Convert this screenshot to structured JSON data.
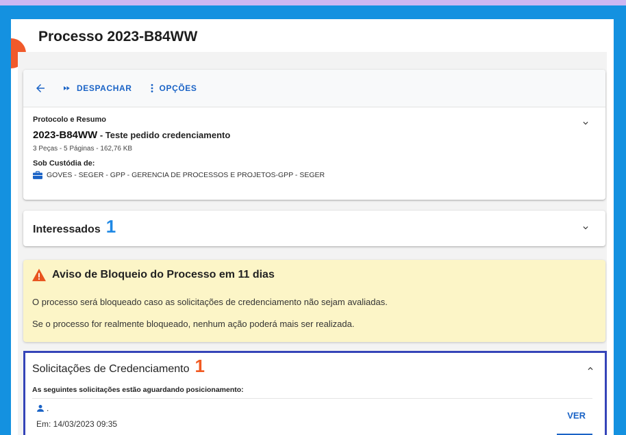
{
  "page": {
    "title": "Processo 2023-B84WW"
  },
  "toolbar": {
    "despachar_label": "DESPACHAR",
    "opcoes_label": "OPÇÕES"
  },
  "protocolo": {
    "section_label": "Protocolo e Resumo",
    "number": "2023-B84WW",
    "summary": " - Teste pedido credenciamento",
    "meta": "3 Peças - 5 Páginas - 162,76 KB",
    "custody_label": "Sob Custódia de:",
    "custody_value": "GOVES - SEGER - GPP - GERENCIA DE PROCESSOS E PROJETOS-GPP - SEGER"
  },
  "interessados": {
    "title": "Interessados",
    "count": "1"
  },
  "aviso": {
    "title": "Aviso de Bloqueio do Processo em 11 dias",
    "line1": "O processo será bloqueado caso as solicitações de credenciamento não sejam avaliadas.",
    "line2": "Se o processo for realmente bloqueado, nenhum ação poderá mais ser realizada."
  },
  "solicitacoes": {
    "title": "Solicitações de Credenciamento",
    "count": "1",
    "subtitle": "As seguintes solicitações estão aguardando posicionamento:",
    "items": [
      {
        "name": ".",
        "date": "Em: 14/03/2023 09:35",
        "action_label": "VER"
      }
    ]
  },
  "colors": {
    "accent_blue": "#1a63c6",
    "count_blue": "#1e88e5",
    "count_orange": "#f15a22",
    "warning_bg": "#fcf5c7",
    "warning_icon": "#e8541e",
    "highlight_border": "#3544b8"
  },
  "icons": [
    "arrow-left-icon",
    "fast-forward-icon",
    "more-vert-icon",
    "chevron-down-icon",
    "briefcase-icon",
    "warning-triangle-icon",
    "chevron-up-icon",
    "person-icon"
  ]
}
